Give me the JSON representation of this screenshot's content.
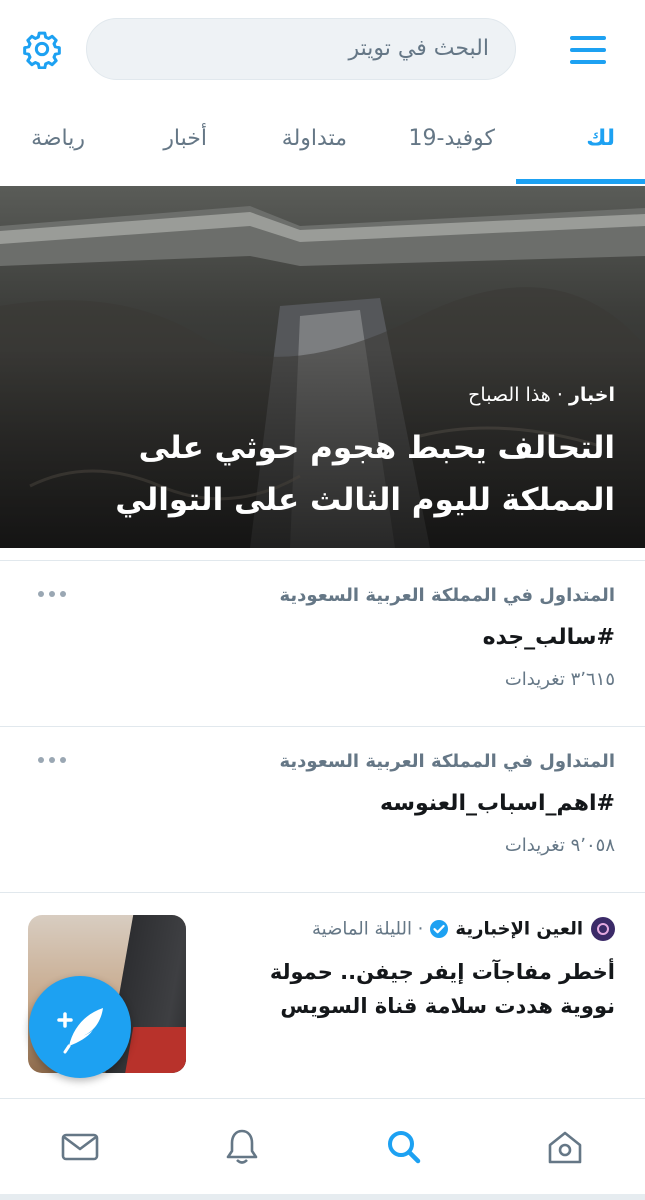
{
  "header": {
    "search_placeholder": "البحث في تويتر",
    "icons": [
      "menu-icon",
      "settings-gear-icon"
    ]
  },
  "tabs": [
    {
      "label": "لك",
      "active": true
    },
    {
      "label": "كوفيد-19",
      "active": false
    },
    {
      "label": "متداولة",
      "active": false
    },
    {
      "label": "أخبار",
      "active": false
    },
    {
      "label": "رياضة",
      "active": false
    }
  ],
  "hero": {
    "category": "اخبار",
    "separator": " · ",
    "time": "هذا الصباح",
    "title": "التحالف يحبط هجوم حوثي على المملكة لليوم الثالث على التوالي"
  },
  "trends": [
    {
      "context": "المتداول في المملكة العربية السعودية",
      "name": "#سالب_جده",
      "count": "٣٬٦١٥ تغريدات"
    },
    {
      "context": "المتداول في المملكة العربية السعودية",
      "name": "#اهم_اسباب_العنوسه",
      "count": "٩٬٠٥٨ تغريدات"
    }
  ],
  "news": {
    "source": "العين الإخبارية",
    "time": "· الليلة الماضية",
    "title": "أخطر مفاجآت إيفر جيفن.. حمولة نووية هددت سلامة قناة السويس"
  },
  "colors": {
    "accent": "#1da1f2",
    "secondary_text": "#657786",
    "primary_text": "#14171a",
    "divider": "#e1e8ed"
  },
  "bottom_nav": [
    "mail-icon",
    "bell-icon",
    "search-icon",
    "home-icon"
  ]
}
